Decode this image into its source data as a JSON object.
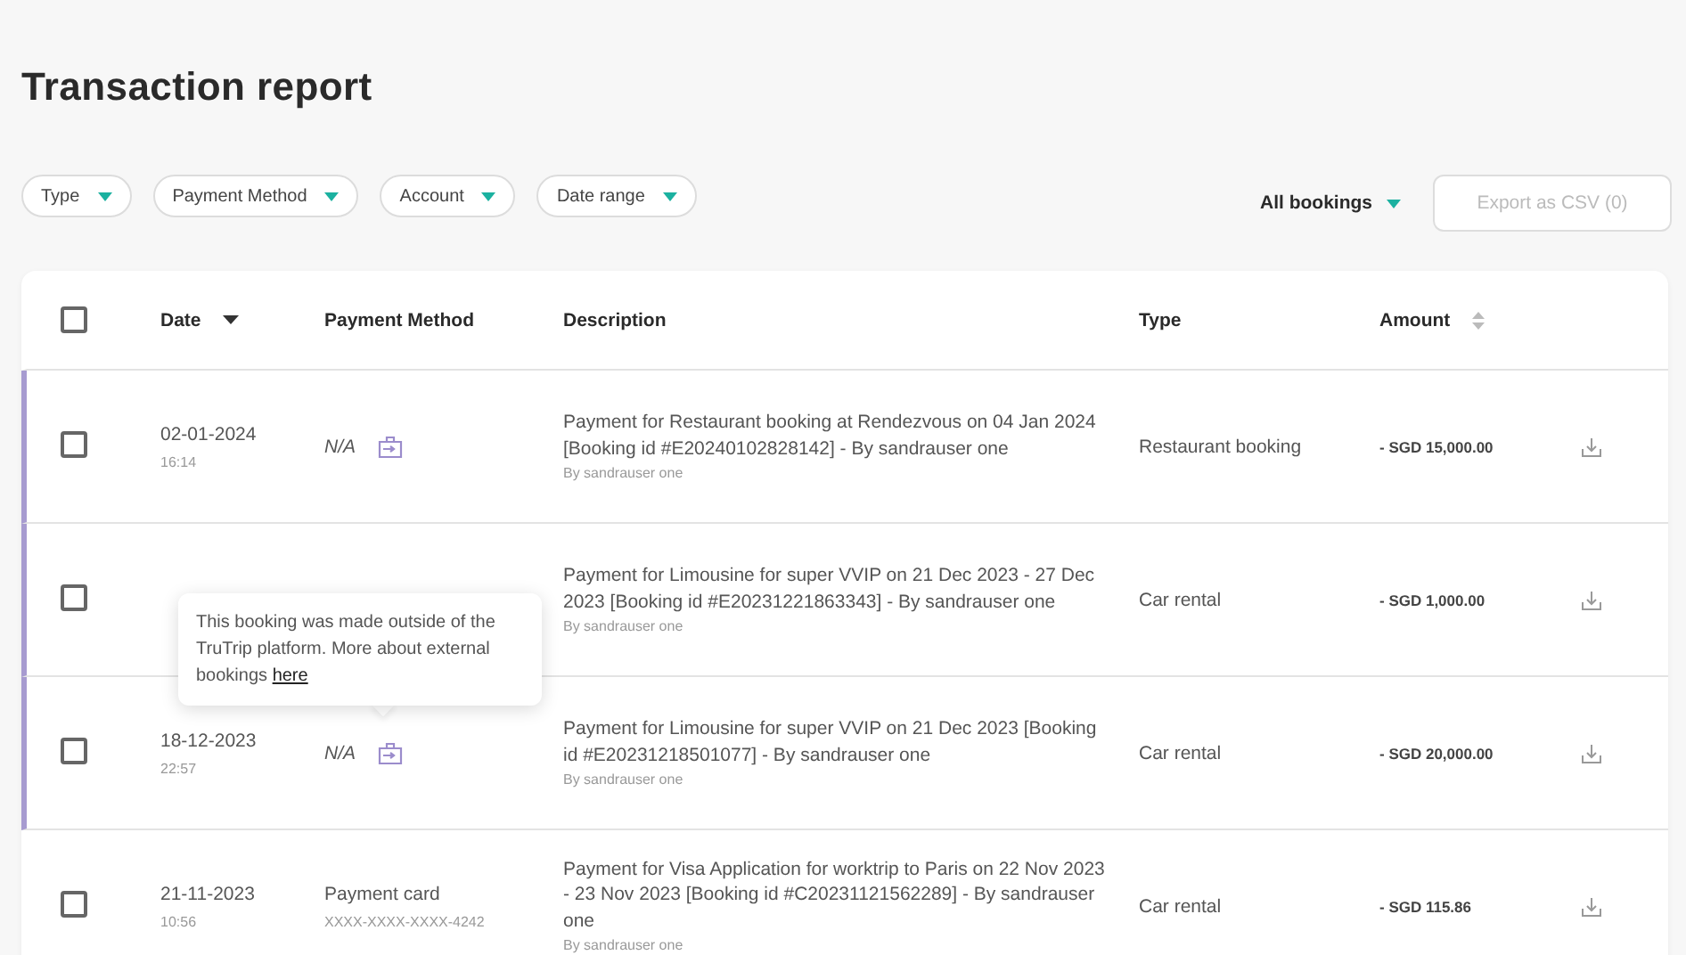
{
  "page": {
    "title": "Transaction report"
  },
  "filters": [
    {
      "label": "Type"
    },
    {
      "label": "Payment Method"
    },
    {
      "label": "Account"
    },
    {
      "label": "Date range"
    }
  ],
  "bookings_filter": {
    "label": "All bookings"
  },
  "export_button": {
    "label": "Export as CSV (0)",
    "disabled": true
  },
  "table": {
    "select_all": {
      "checked": false
    },
    "columns": [
      {
        "label": "Date",
        "sorted": true,
        "sortable": true
      },
      {
        "label": "Payment Method",
        "sorted": false,
        "sortable": false
      },
      {
        "label": "Description",
        "sorted": false,
        "sortable": false
      },
      {
        "label": "Type",
        "sorted": false,
        "sortable": false
      },
      {
        "label": "Amount",
        "sorted": false,
        "sortable": true
      }
    ],
    "rows": [
      {
        "checked": false,
        "external": true,
        "date": "02-01-2024",
        "time": "16:14",
        "payment": "N/A",
        "description": "Payment for Restaurant booking at Rendezvous on 04 Jan 2024 [Booking id #E20240102828142] - By sandrauser one",
        "by": "By sandrauser one",
        "type": "Restaurant booking",
        "amount": "- SGD 15,000.00"
      },
      {
        "checked": false,
        "external": true,
        "description": "Payment for Limousine for super VVIP on 21 Dec 2023 - 27 Dec 2023 [Booking id #E20231221863343] - By sandrauser one",
        "by": "By sandrauser one",
        "type": "Car rental",
        "amount": "- SGD 1,000.00"
      },
      {
        "checked": false,
        "external": true,
        "date": "18-12-2023",
        "time": "22:57",
        "payment": "N/A",
        "description": "Payment for Limousine for super VVIP on 21 Dec 2023 [Booking id #E20231218501077] - By sandrauser one",
        "by": "By sandrauser one",
        "type": "Car rental",
        "amount": "- SGD 20,000.00",
        "tooltip": {
          "text": "This booking was made outside of the TruTrip platform. More about external bookings ",
          "link": "here"
        }
      },
      {
        "checked": false,
        "external": false,
        "date": "21-11-2023",
        "time": "10:56",
        "payment": "Payment card",
        "card": "XXXX-XXXX-XXXX-4242",
        "description": "Payment for Visa Application for worktrip to Paris on 22 Nov 2023 - 23 Nov 2023 [Booking id #C20231121562289] - By sandrauser one",
        "by": "By sandrauser one",
        "type": "Car rental",
        "amount": "- SGD 115.86"
      }
    ]
  }
}
